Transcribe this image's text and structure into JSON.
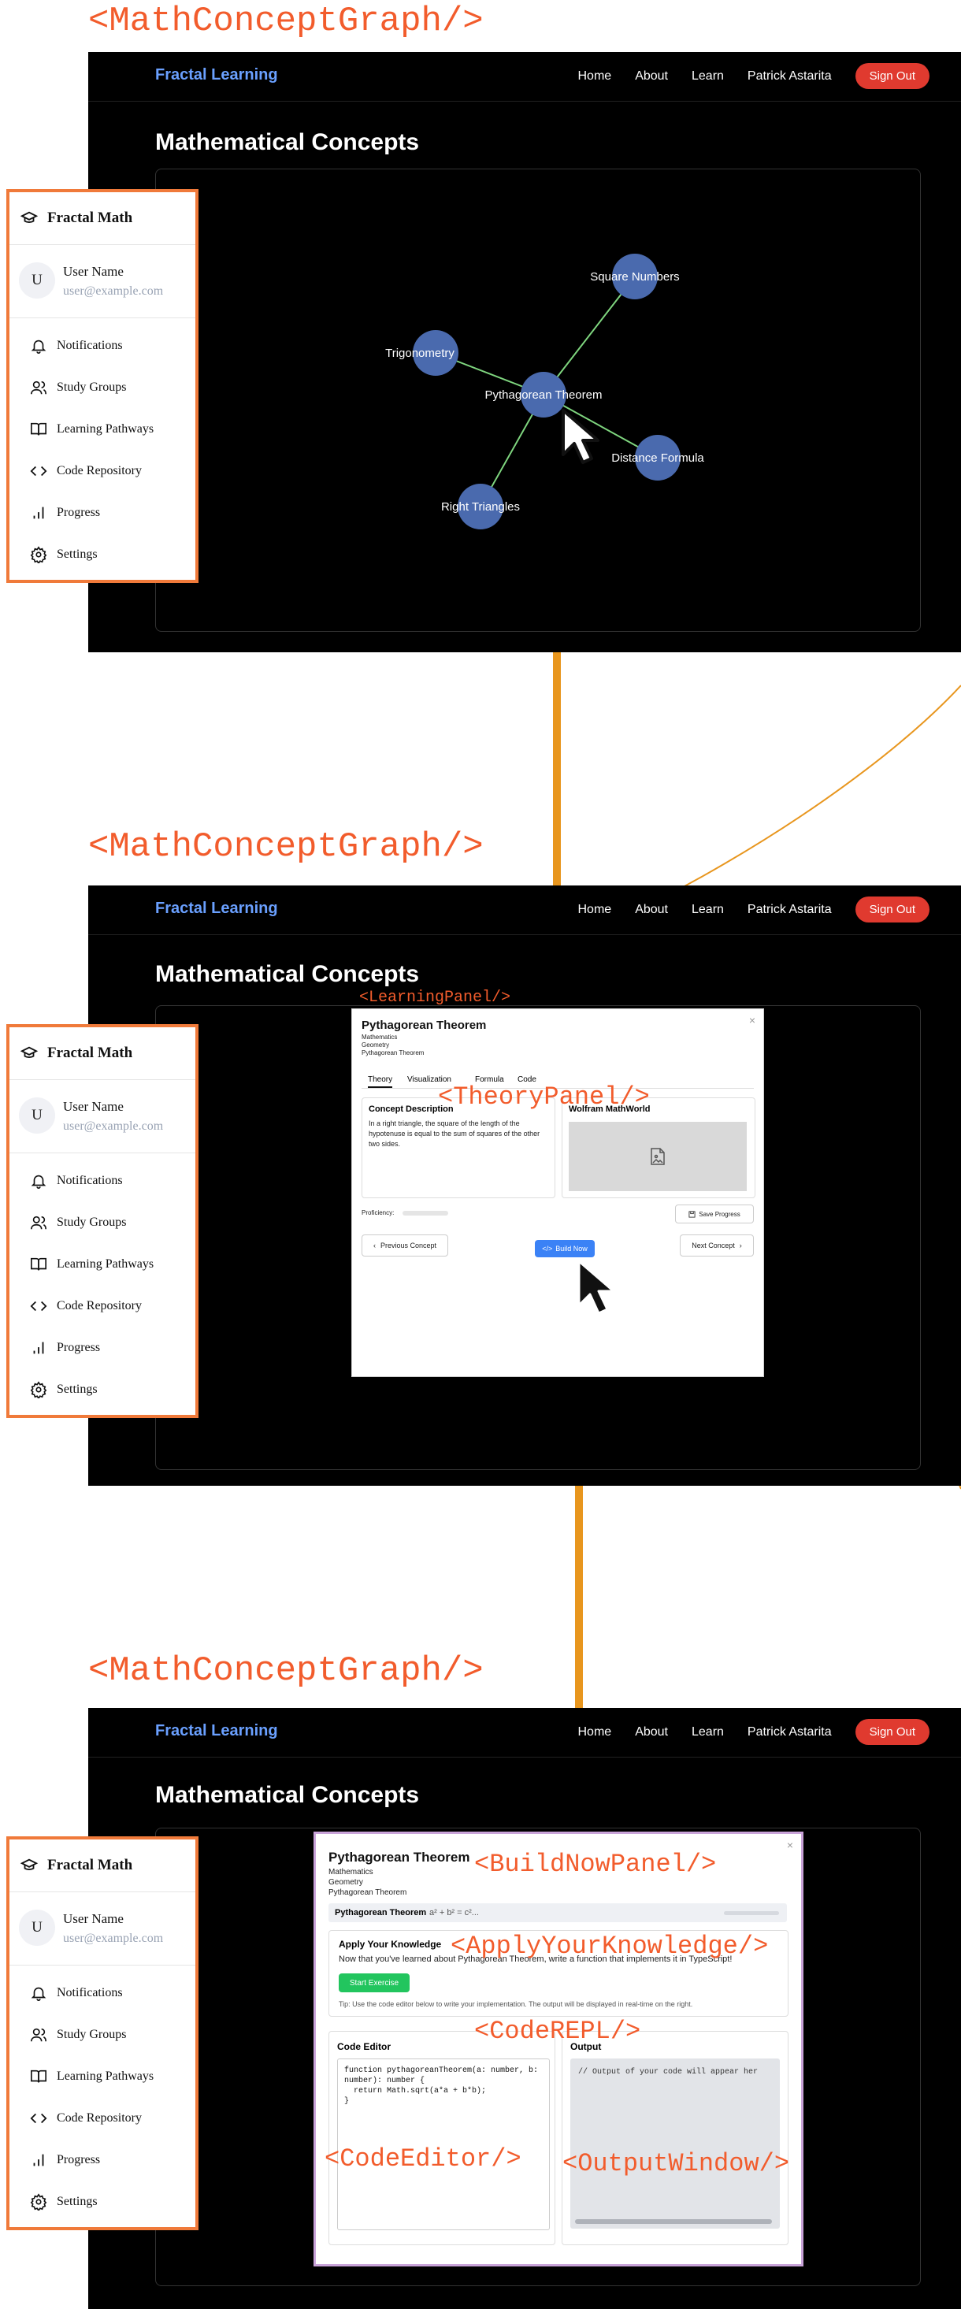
{
  "labels": {
    "graph": "<MathConceptGraph/>",
    "learning_panel": "<LearningPanel/>",
    "theory_panel": "<TheoryPanel/>",
    "build_now_panel": "<BuildNowPanel/>",
    "apply_knowledge": "<ApplyYourKnowledge/>",
    "code_repl": "<CodeREPL/>",
    "code_editor": "<CodeEditor/>",
    "output_window": "<OutputWindow/>"
  },
  "nav": {
    "brand": "Fractal Learning",
    "links": [
      "Home",
      "About",
      "Learn",
      "Patrick Astarita"
    ],
    "signout": "Sign Out"
  },
  "page_title": "Mathematical Concepts",
  "sidebar": {
    "title": "Fractal Math",
    "avatar_initial": "U",
    "user_name": "User Name",
    "user_email": "user@example.com",
    "items": [
      {
        "label": "Notifications",
        "icon": "bell-icon"
      },
      {
        "label": "Study Groups",
        "icon": "users-icon"
      },
      {
        "label": "Learning Pathways",
        "icon": "book-open-icon"
      },
      {
        "label": "Code Repository",
        "icon": "code-icon"
      },
      {
        "label": "Progress",
        "icon": "bar-chart-icon"
      },
      {
        "label": "Settings",
        "icon": "gear-icon"
      }
    ]
  },
  "graph_nodes": {
    "center": "Pythagorean Theorem",
    "square": "Square Numbers",
    "trig": "Trigonometry",
    "distance": "Distance Formula",
    "right": "Right Triangles"
  },
  "learning_panel": {
    "title": "Pythagorean Theorem",
    "crumbs": [
      "Mathematics",
      "Geometry",
      "Pythagorean Theorem"
    ],
    "tabs": [
      "Theory",
      "Visualization",
      "Formula",
      "Code"
    ],
    "concept_heading": "Concept Description",
    "concept_text": "In a right triangle, the square of the length of the hypotenuse is equal to the sum of squares of the other two sides.",
    "wolfram_heading": "Wolfram MathWorld",
    "proficiency": "Proficiency:",
    "proficiency_value": 0,
    "save": "Save Progress",
    "prev": "Previous Concept",
    "build": "Build Now",
    "next": "Next Concept",
    "close": "×"
  },
  "build_panel": {
    "title": "Pythagorean Theorem",
    "crumbs": [
      "Mathematics",
      "Geometry",
      "Pythagorean Theorem"
    ],
    "strip_title": "Pythagorean Theorem",
    "strip_formula": "a² + b² = c²...",
    "apply_heading": "Apply Your Knowledge",
    "apply_text": "Now that you've learned about Pythagorean Theorem, write a function that implements it in TypeScript!",
    "start": "Start Exercise",
    "tip": "Tip: Use the code editor below to write your implementation. The output will be displayed in real-time on the right.",
    "editor_heading": "Code Editor",
    "code": "function pythagoreanTheorem(a: number, b:\nnumber): number {\n  return Math.sqrt(a*a + b*b);\n}",
    "output_heading": "Output",
    "output_text": "// Output of your code will appear her",
    "close": "×"
  },
  "colors": {
    "accent_orange": "#f25c2c",
    "arrow": "#e8961e",
    "node": "#4a6aae",
    "edge": "#7fd67f",
    "signout": "#e03a2f",
    "brand": "#6aa0ff"
  }
}
